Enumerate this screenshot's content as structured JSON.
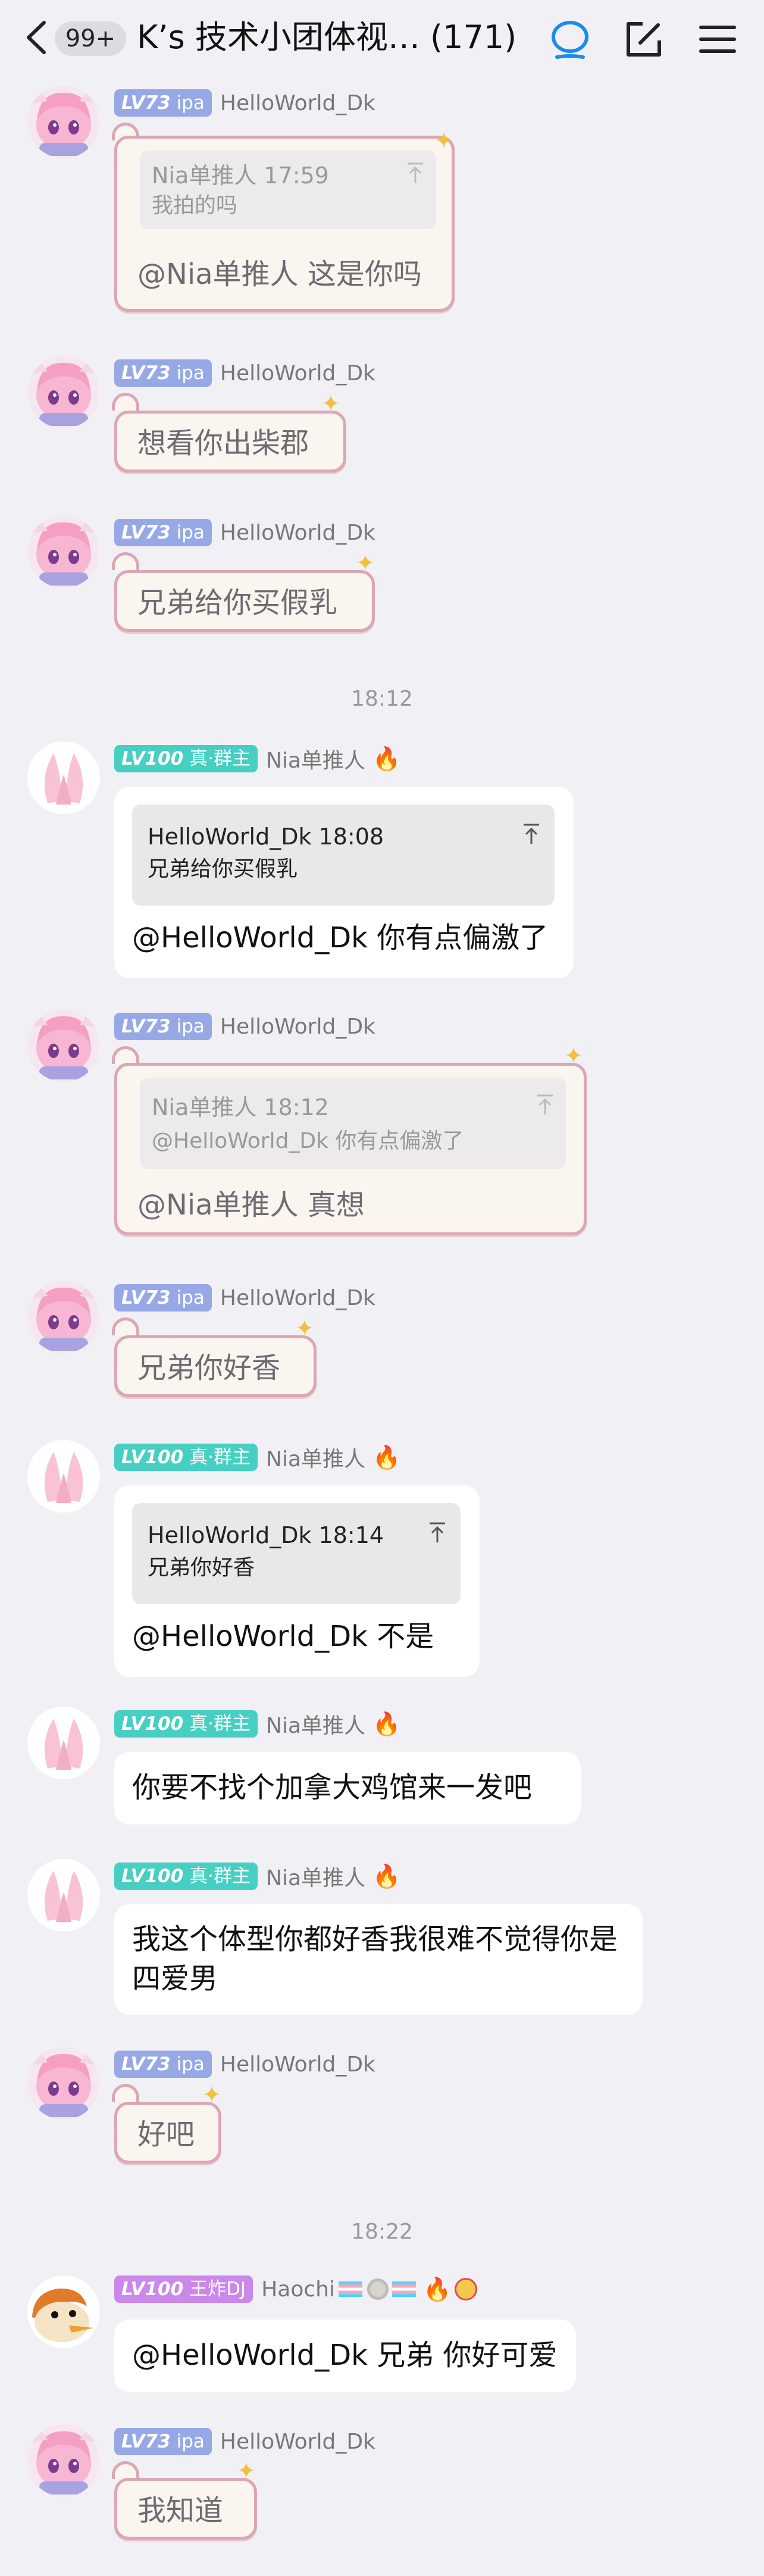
{
  "header": {
    "back_icon": "chevron-left-icon",
    "unread_badge": "99+",
    "title": "K’s 技术小团体视… (171)",
    "icons": [
      "chat-bubble-icon",
      "edit-icon",
      "menu-icon"
    ]
  },
  "users": {
    "ipa": {
      "level": "LV73",
      "title": "ipa",
      "name": "HelloWorld_Dk"
    },
    "nia": {
      "level": "LV100",
      "title": "真·群主",
      "name": "Nia单推人",
      "emoji": "🔥"
    },
    "haochi": {
      "level": "LV100",
      "title": "王炸DJ",
      "name": "Haochi",
      "emoji": "🔥"
    }
  },
  "messages": [
    {
      "sender": "ipa",
      "quote_name": "Nia单推人 17:59",
      "quote_text": "我拍的吗",
      "text": "@Nia单推人 这是你吗"
    },
    {
      "sender": "ipa",
      "text": "想看你出柴郡"
    },
    {
      "sender": "ipa",
      "text": "兄弟给你买假乳"
    },
    {
      "sender": "nia",
      "quote_name": "HelloWorld_Dk 18:08",
      "quote_text": "兄弟给你买假乳",
      "text": "@HelloWorld_Dk 你有点偏激了"
    },
    {
      "sender": "ipa",
      "quote_name": "Nia单推人 18:12",
      "quote_text": "@HelloWorld_Dk 你有点偏激了",
      "text": "@Nia单推人 真想"
    },
    {
      "sender": "ipa",
      "text": "兄弟你好香"
    },
    {
      "sender": "nia",
      "quote_name": "HelloWorld_Dk 18:14",
      "quote_text": "兄弟你好香",
      "text": "@HelloWorld_Dk 不是"
    },
    {
      "sender": "nia",
      "text": "你要不找个加拿大鸡馆来一发吧"
    },
    {
      "sender": "nia",
      "text": "我这个体型你都好香我很难不觉得你是四爱男"
    },
    {
      "sender": "ipa",
      "text": "好吧"
    },
    {
      "sender": "haochi",
      "text": "@HelloWorld_Dk 兄弟 你好可爱"
    },
    {
      "sender": "ipa",
      "text": "我知道"
    }
  ],
  "timestamps": [
    "18:12",
    "18:22"
  ]
}
